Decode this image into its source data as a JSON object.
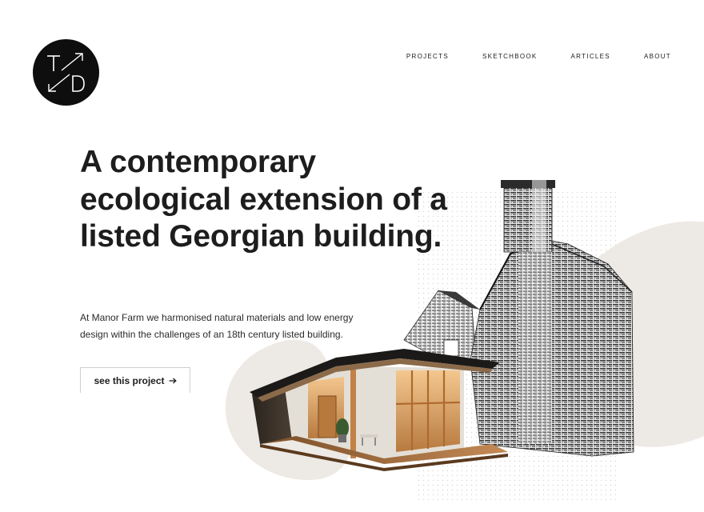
{
  "logo": {
    "letters": [
      "T",
      "D"
    ],
    "icon": "td-monogram-logo"
  },
  "nav": {
    "items": [
      {
        "label": "PROJECTS"
      },
      {
        "label": "SKETCHBOOK"
      },
      {
        "label": "ARTICLES"
      },
      {
        "label": "ABOUT"
      }
    ]
  },
  "hero": {
    "headline": "A contemporary ecological extension of a listed Georgian building.",
    "description": "At Manor Farm we harmonised natural materials and low energy design within the challenges of an 18th century listed building.",
    "cta_label": "see this project",
    "cta_icon": "arrow-right-icon"
  },
  "colors": {
    "text": "#1d1d1d",
    "logo_bg": "#0e0e0e",
    "blob": "#ede9e4",
    "wood": "#c9884a",
    "button_border": "#cfcfcf"
  }
}
